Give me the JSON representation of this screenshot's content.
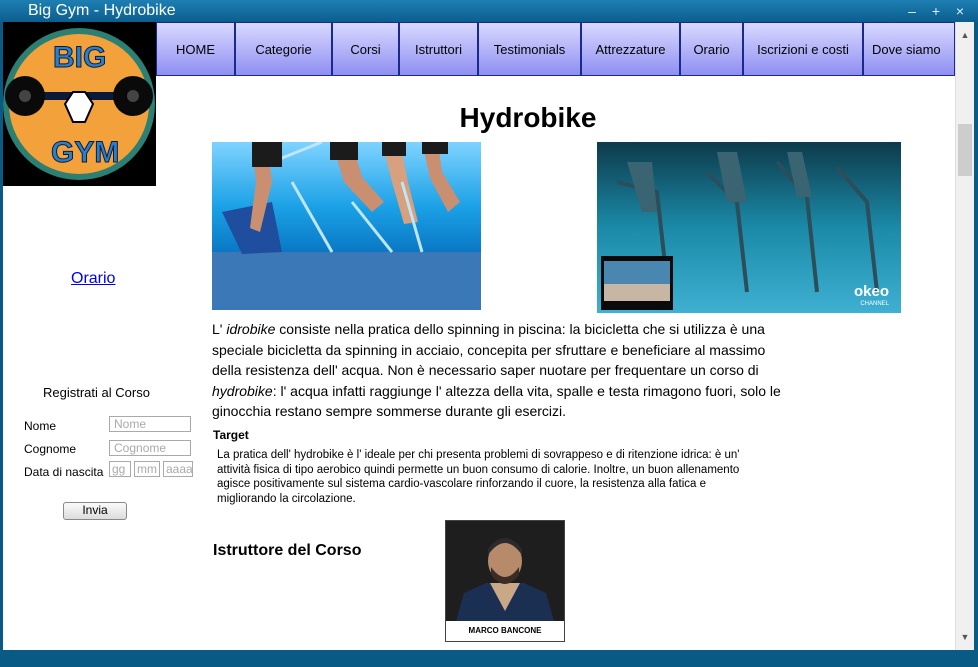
{
  "window": {
    "title": "Big Gym - Hydrobike",
    "min": "–",
    "max": "+",
    "close": "×"
  },
  "logo": {
    "top_text": "BIG",
    "bottom_text": "GYM"
  },
  "nav": [
    "HOME",
    "Categorie",
    "Corsi",
    "Istruttori",
    "Testimonials",
    "Attrezzature",
    "Orario",
    "Iscrizioni e costi",
    "Dove siamo"
  ],
  "sidebar": {
    "link": "Orario",
    "form": {
      "title": "Registrati al Corso",
      "name_label": "Nome",
      "name_placeholder": "Nome",
      "surname_label": "Cognome",
      "surname_placeholder": "Cognome",
      "dob_label": "Data di nascita",
      "dob_day": "gg",
      "dob_month": "mm",
      "dob_year": "aaaa",
      "submit": "Invia"
    }
  },
  "main": {
    "title": "Hydrobike",
    "video_brand": "okeo",
    "video_brand_sub": "CHANNEL",
    "intro_1": "L' ",
    "intro_em1": "idrobike",
    "intro_2": " consiste nella pratica dello spinning in piscina: la bicicletta che si utilizza è una speciale bicicletta da spinning in acciaio, concepita per sfruttare e beneficiare al massimo della resistenza dell' acqua. Non è necessario saper nuotare per frequentare un corso di ",
    "intro_em2": "hydrobike",
    "intro_3": ": l' acqua infatti raggiunge l' altezza della vita, spalle e testa rimagono fuori, solo le ginocchia restano sempre sommerse durante gli esercizi.",
    "target_heading": "Target",
    "target_text": "La pratica dell' hydrobike è l' ideale per chi presenta problemi di sovrappeso e di ritenzione idrica: è un' attività fisica di tipo aerobico quindi permette un buon consumo di calorie. Inoltre, un buon allenamento agisce positivamente sul sistema cardio-vascolare rinforzando il cuore, la resistenza alla fatica e migliorando la circolazione.",
    "instructor_heading": "Istruttore del Corso",
    "instructor_name": "MARCO BANCONE"
  }
}
